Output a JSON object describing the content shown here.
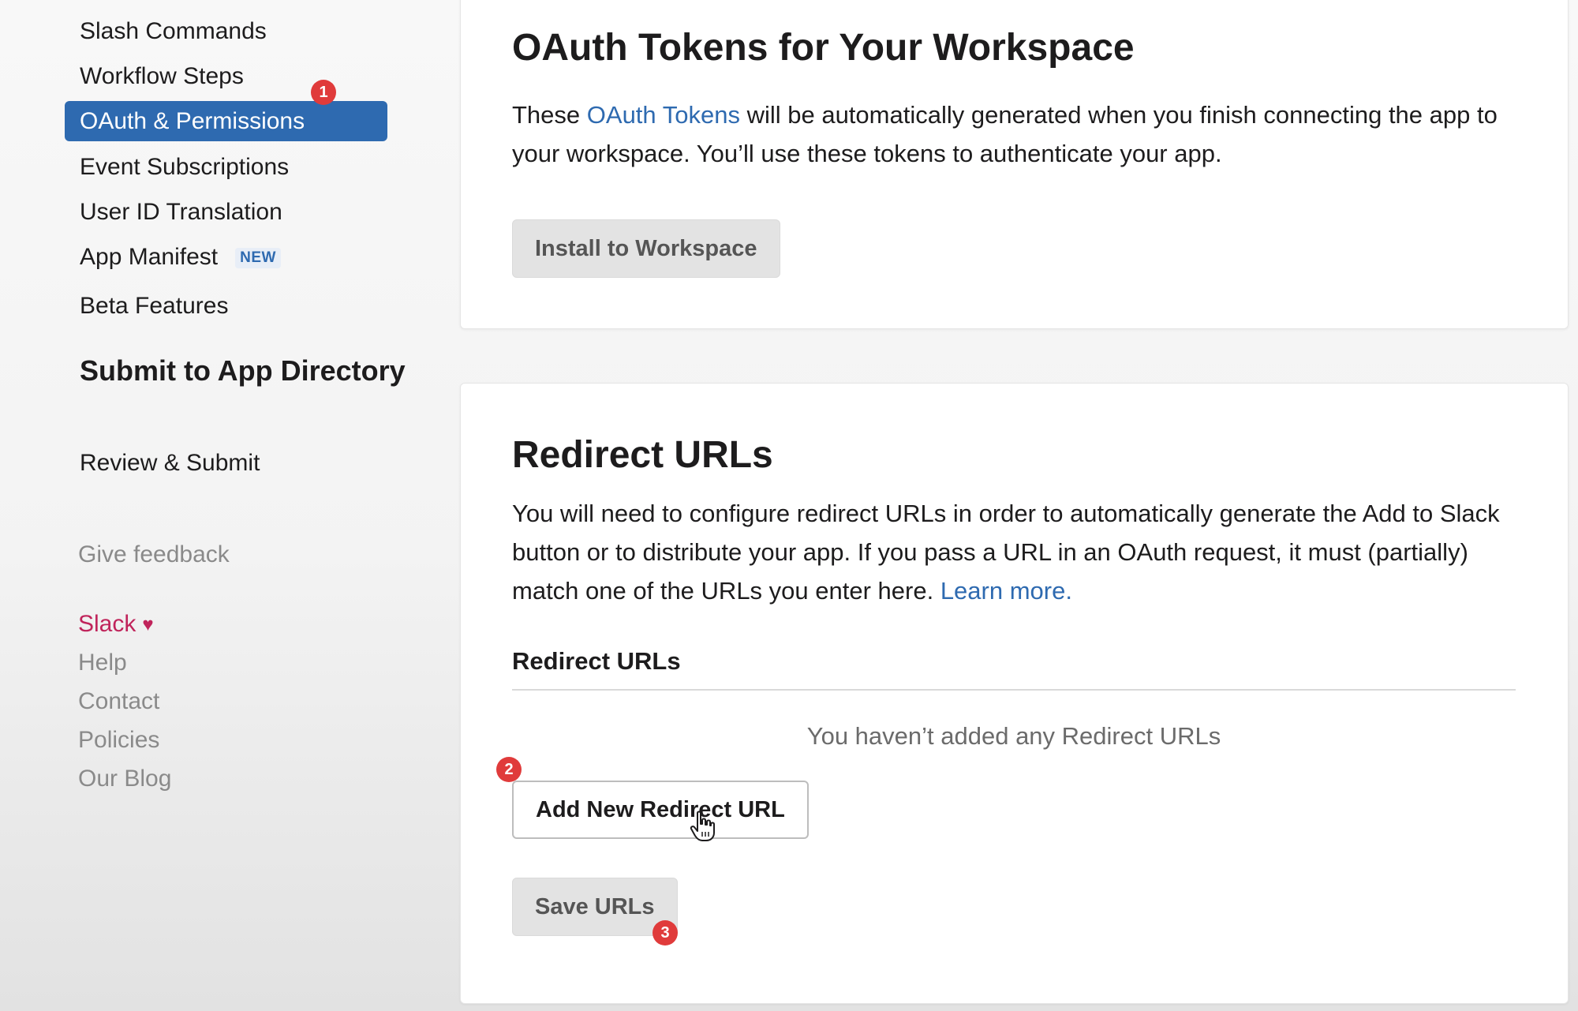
{
  "sidebar": {
    "items": [
      {
        "label": "Slash Commands"
      },
      {
        "label": "Workflow Steps"
      },
      {
        "label": "OAuth & Permissions",
        "active": true
      },
      {
        "label": "Event Subscriptions"
      },
      {
        "label": "User ID Translation"
      },
      {
        "label": "App Manifest",
        "badge": "NEW"
      },
      {
        "label": "Beta Features"
      }
    ],
    "section_heading": "Submit to App Directory",
    "section_items": [
      {
        "label": "Review & Submit"
      }
    ],
    "feedback": "Give feedback",
    "footer_links": [
      {
        "label": "Slack"
      },
      {
        "label": "Help"
      },
      {
        "label": "Contact"
      },
      {
        "label": "Policies"
      },
      {
        "label": "Our Blog"
      }
    ]
  },
  "oauth_card": {
    "title": "OAuth Tokens for Your Workspace",
    "description_prefix": "These ",
    "description_link": "OAuth Tokens",
    "description_suffix": " will be automatically generated when you finish connecting the app to your workspace. You’ll use these tokens to authenticate your app.",
    "install_button": "Install to Workspace"
  },
  "redirect_card": {
    "title": "Redirect URLs",
    "description": "You will need to configure redirect URLs in order to automatically generate the Add to Slack button or to distribute your app. If you pass a URL in an OAuth request, it must (partially) match one of the URLs you enter here. ",
    "learn_more": "Learn more.",
    "subheading": "Redirect URLs",
    "empty_text": "You haven’t added any Redirect URLs",
    "add_button": "Add New Redirect URL",
    "save_button": "Save URLs"
  },
  "annotations": [
    "1",
    "2",
    "3"
  ],
  "colors": {
    "accent": "#2e6ab0",
    "slack_pink": "#c0245b",
    "annotation_red": "#e03b3b"
  },
  "icons": {
    "heart": "heart-icon",
    "cursor": "hand-pointer-icon"
  }
}
